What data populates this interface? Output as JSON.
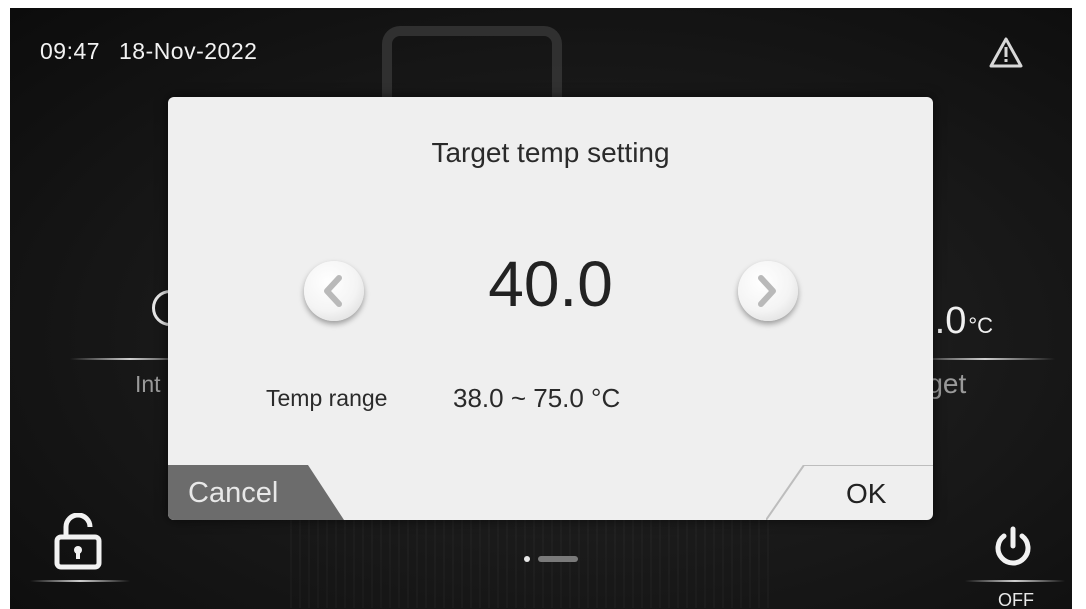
{
  "status_bar": {
    "time": "09:47",
    "date": "18-Nov-2022",
    "warning_icon": "warning-triangle-icon"
  },
  "background": {
    "left_label_partial": "Int",
    "right_value_partial": ").0",
    "right_value_unit": "°C",
    "right_label_partial": "rget"
  },
  "dialog": {
    "title": "Target temp setting",
    "value": "40.0",
    "decrease_icon": "chevron-left-icon",
    "increase_icon": "chevron-right-icon",
    "range_label": "Temp range",
    "range_value": "38.0 ~ 75.0 °C",
    "cancel_label": "Cancel",
    "ok_label": "OK"
  },
  "footer": {
    "lock_icon": "unlock-icon",
    "power_icon": "power-icon",
    "power_state": "OFF",
    "pagination": {
      "pages": 2,
      "current": 1
    }
  },
  "colors": {
    "dialog_bg": "#efefef",
    "cancel_bg": "#6c6c6c",
    "screen_bg": "#1a1a1a"
  }
}
